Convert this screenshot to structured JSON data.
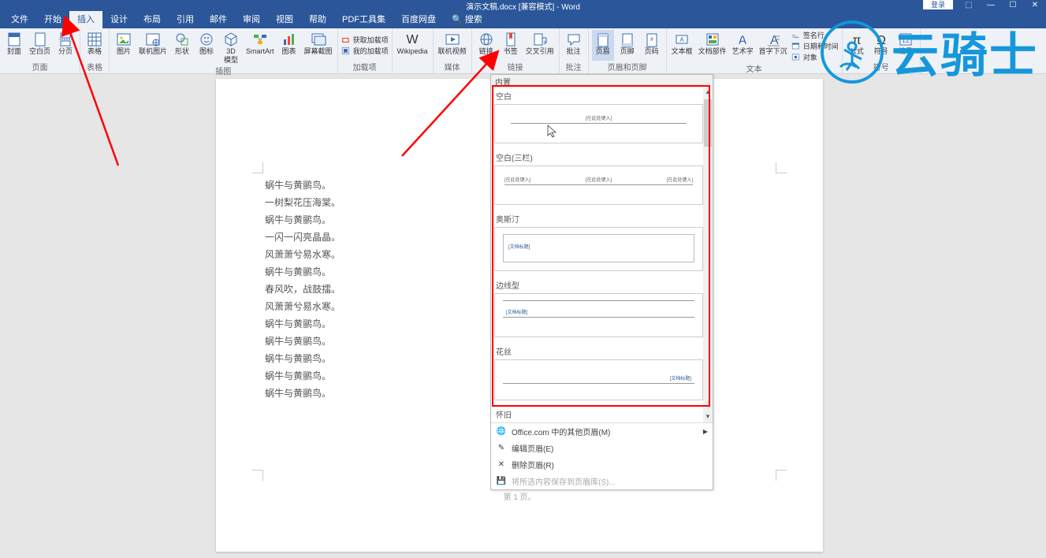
{
  "title": "演示文稿.docx [兼容模式] - Word",
  "login": "登录",
  "tabs": [
    "文件",
    "开始",
    "插入",
    "设计",
    "布局",
    "引用",
    "邮件",
    "审阅",
    "视图",
    "帮助",
    "PDF工具集",
    "百度网盘"
  ],
  "tabs_search": "搜索",
  "active_tab_index": 2,
  "ribbon": {
    "groups": [
      {
        "label": "页面",
        "buttons": [
          {
            "icon": "cover-page",
            "label": "封面"
          },
          {
            "icon": "blank-page",
            "label": "空白页"
          },
          {
            "icon": "page-break",
            "label": "分页"
          }
        ]
      },
      {
        "label": "表格",
        "buttons": [
          {
            "icon": "table",
            "label": "表格"
          }
        ]
      },
      {
        "label": "插图",
        "buttons": [
          {
            "icon": "picture",
            "label": "图片"
          },
          {
            "icon": "online-pic",
            "label": "联机图片"
          },
          {
            "icon": "shapes",
            "label": "形状"
          },
          {
            "icon": "icons",
            "label": "图标"
          },
          {
            "icon": "3d-model",
            "label": "3D\n模型"
          },
          {
            "icon": "smartart",
            "label": "SmartArt"
          },
          {
            "icon": "chart",
            "label": "图表"
          },
          {
            "icon": "screenshot",
            "label": "屏幕截图"
          }
        ]
      },
      {
        "label": "加载项",
        "rows": [
          {
            "icon": "store",
            "label": "获取加载项"
          },
          {
            "icon": "myaddins",
            "label": "我的加载项"
          }
        ]
      },
      {
        "label": "",
        "buttons": [
          {
            "icon": "wikipedia",
            "label": "Wikipedia"
          }
        ]
      },
      {
        "label": "媒体",
        "buttons": [
          {
            "icon": "online-video",
            "label": "联机视频"
          }
        ]
      },
      {
        "label": "链接",
        "buttons": [
          {
            "icon": "link",
            "label": "链接"
          },
          {
            "icon": "bookmark",
            "label": "书签"
          },
          {
            "icon": "crossref",
            "label": "交叉引用"
          }
        ]
      },
      {
        "label": "批注",
        "buttons": [
          {
            "icon": "comment",
            "label": "批注"
          }
        ]
      },
      {
        "label": "页眉和页脚",
        "buttons": [
          {
            "icon": "header",
            "label": "页眉",
            "active": true
          },
          {
            "icon": "footer",
            "label": "页脚"
          },
          {
            "icon": "pagenum",
            "label": "页码"
          }
        ]
      },
      {
        "label": "文本",
        "buttons": [
          {
            "icon": "textbox",
            "label": "文本框"
          },
          {
            "icon": "quickparts",
            "label": "文档部件"
          },
          {
            "icon": "wordart",
            "label": "艺术字"
          },
          {
            "icon": "dropcap",
            "label": "首字下沉"
          }
        ],
        "rows": [
          {
            "icon": "sigline",
            "label": "签名行"
          },
          {
            "icon": "datetime",
            "label": "日期和时间"
          },
          {
            "icon": "object",
            "label": "对象"
          }
        ]
      },
      {
        "label": "符号",
        "buttons": [
          {
            "icon": "equation",
            "label": "公式"
          },
          {
            "icon": "symbol",
            "label": "符号"
          },
          {
            "icon": "number",
            "label": "编号"
          }
        ]
      }
    ]
  },
  "document_lines": [
    "蜗牛与黄鹂鸟。",
    "一树梨花压海棠。",
    "蜗牛与黄鹂鸟。",
    "一闪一闪亮晶晶。",
    "风萧萧兮易水寒。",
    "蜗牛与黄鹂鸟。",
    "春风吹，战鼓擂。",
    "风萧萧兮易水寒。",
    "蜗牛与黄鹂鸟。",
    "蜗牛与黄鹂鸟。",
    "蜗牛与黄鹂鸟。",
    "蜗牛与黄鹂鸟。",
    "蜗牛与黄鹂鸟。"
  ],
  "page_footer": "第 1 页。",
  "dropdown": {
    "section": "内置",
    "items": [
      {
        "name": "空白",
        "type": "blank"
      },
      {
        "name": "空白(三栏)",
        "type": "blank3"
      },
      {
        "name": "奥斯汀",
        "type": "austin"
      },
      {
        "name": "边线型",
        "type": "sideline"
      },
      {
        "name": "花丝",
        "type": "filigree"
      },
      {
        "name": "怀旧",
        "type": "retro"
      }
    ],
    "footer": [
      {
        "icon": "office",
        "label": "Office.com 中的其他页眉(M)",
        "arrow": true
      },
      {
        "icon": "edit",
        "label": "编辑页眉(E)"
      },
      {
        "icon": "remove",
        "label": "删除页眉(R)"
      },
      {
        "icon": "save",
        "label": "将所选内容保存到页眉库(S)...",
        "disabled": true
      }
    ]
  },
  "watermark": "云骑士",
  "placeholder_text": "[在此处键入]",
  "placeholder_doc_title": "[文档标题]"
}
